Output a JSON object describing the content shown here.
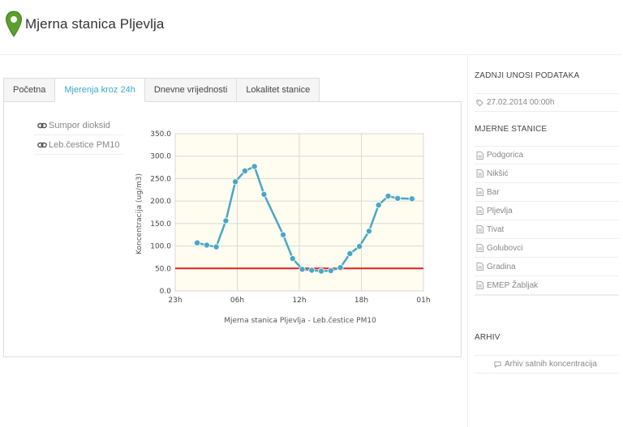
{
  "header": {
    "title": "Mjerna stanica Pljevlja",
    "icon": "map-pin-icon",
    "icon_color": "#5aa02c"
  },
  "tabs": [
    {
      "label": "Početna",
      "active": false
    },
    {
      "label": "Mjerenja kroz 24h",
      "active": true
    },
    {
      "label": "Dnevne vrijednosti",
      "active": false
    },
    {
      "label": "Lokalitet stanice",
      "active": false
    }
  ],
  "legend": {
    "items": [
      {
        "label": "Sumpor dioksid",
        "icon": "link-icon"
      },
      {
        "label": "Leb.čestice PM10",
        "icon": "link-icon"
      }
    ]
  },
  "chart_data": {
    "type": "line",
    "ylabel": "Koncentracija (ug/m3)",
    "xlabel": "Mjerna stanica Pljevlja - Leb.čestice PM10",
    "ylim": [
      0,
      350
    ],
    "y_ticks": [
      "0.0",
      "50.0",
      "100.0",
      "150.0",
      "200.0",
      "250.0",
      "300.0",
      "350.0"
    ],
    "x_ticks": [
      "23h",
      "06h",
      "12h",
      "18h",
      "01h"
    ],
    "x_range_hours": [
      0,
      26
    ],
    "grid": true,
    "series_color": "#4aa7c4",
    "limit_color": "#e02020",
    "limit_value": 50,
    "series": [
      {
        "x": [
          2.3,
          3.3,
          4.3,
          5.3,
          6.3,
          7.3,
          8.3,
          9.3,
          11.3,
          12.3,
          13.3,
          14.3,
          15.3,
          16.3,
          17.3,
          18.3,
          19.3,
          20.3,
          21.3,
          22.3,
          23.3,
          24.8
        ],
        "values": [
          107,
          102,
          98,
          156,
          243,
          267,
          277,
          215,
          125,
          72,
          48,
          46,
          44,
          45,
          52,
          83,
          99,
          133,
          191,
          211,
          206,
          205
        ]
      }
    ]
  },
  "sidebar": {
    "last_entries_heading": "ZADNJI UNOSI PODATAKA",
    "last_entry": "27.02.2014 00:00h",
    "stations_heading": "MJERNE STANICE",
    "stations": [
      "Podgorica",
      "Nikšić",
      "Bar",
      "Pljevlja",
      "Tivat",
      "Golubovci",
      "Gradina",
      "EMEP Žabljak"
    ],
    "archive_heading": "ARHIV",
    "archive_link": "Arhiv satnih koncentracija"
  }
}
